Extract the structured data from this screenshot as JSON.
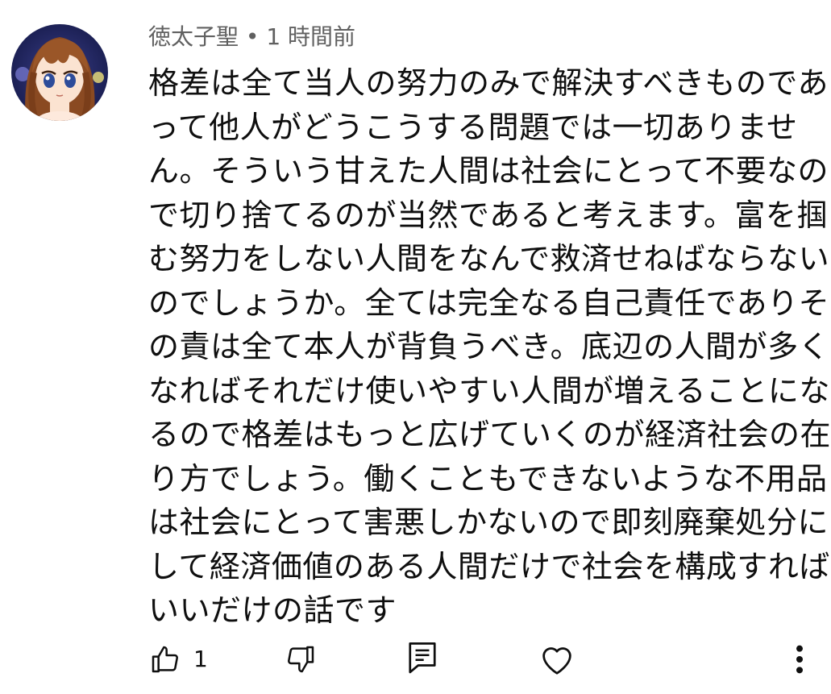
{
  "comment": {
    "author": "徳太子聖",
    "separator": " • ",
    "timestamp": "1 時間前",
    "lines": [
      "格差は全て当人の努力のみで解決すべきものであ",
      "って他人がどうこうする問題では一切ありませ",
      "ん。そういう甘えた人間は社会にとって不要なの",
      "で切り捨てるのが当然であると考えます。富を掴",
      "む努力をしない人間をなんで救済せねばならない",
      "のでしょうか。全ては完全なる自己責任でありそ",
      "の責は全て本人が背負うべき。底辺の人間が多く",
      "なればそれだけ使いやすい人間が増えることにな",
      "るので格差はもっと広げていくのが経済社会の在",
      "り方でしょう。働くこともできないような不用品",
      "は社会にとって害悪しかないので即刻廃棄処分に",
      "して経済価値のある人間だけで社会を構成すれば",
      "いいだけの話です"
    ]
  },
  "actions": {
    "like_count": "1",
    "icons": {
      "like": "thumbs-up-icon",
      "dislike": "thumbs-down-icon",
      "reply": "reply-comment-icon",
      "heart": "heart-icon",
      "more": "more-vertical-icon"
    }
  },
  "colors": {
    "text": "#0f0f0f",
    "meta": "#606060",
    "background": "#ffffff"
  }
}
